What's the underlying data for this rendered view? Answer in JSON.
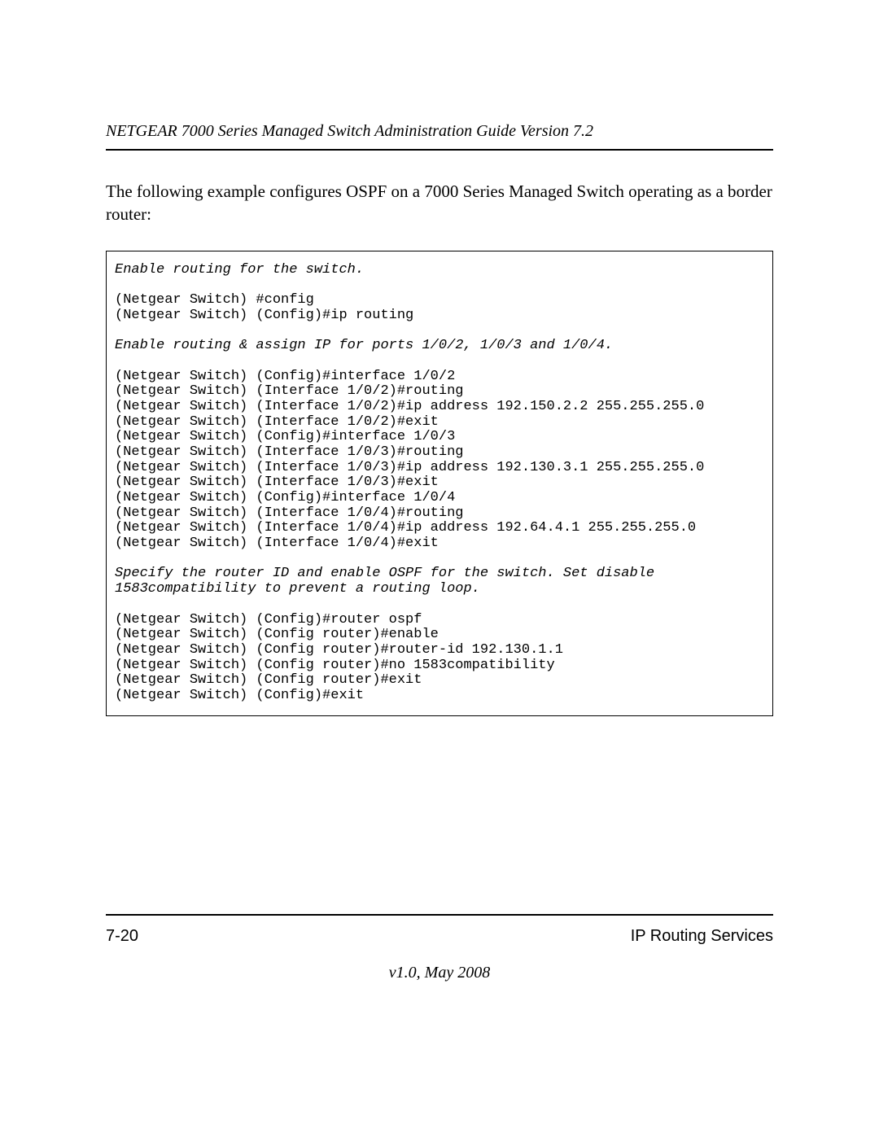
{
  "header": {
    "title": "NETGEAR 7000 Series Managed Switch Administration Guide Version 7.2"
  },
  "body": {
    "intro": "The following example configures OSPF on a 7000 Series Managed Switch operating as a border router:"
  },
  "code": {
    "comment1": "Enable routing for the switch.",
    "block1": "(Netgear Switch) #config\n(Netgear Switch) (Config)#ip routing",
    "comment2": "Enable routing & assign IP for ports 1/0/2, 1/0/3 and 1/0/4.",
    "block2": "(Netgear Switch) (Config)#interface 1/0/2\n(Netgear Switch) (Interface 1/0/2)#routing\n(Netgear Switch) (Interface 1/0/2)#ip address 192.150.2.2 255.255.255.0\n(Netgear Switch) (Interface 1/0/2)#exit\n(Netgear Switch) (Config)#interface 1/0/3\n(Netgear Switch) (Interface 1/0/3)#routing\n(Netgear Switch) (Interface 1/0/3)#ip address 192.130.3.1 255.255.255.0\n(Netgear Switch) (Interface 1/0/3)#exit\n(Netgear Switch) (Config)#interface 1/0/4\n(Netgear Switch) (Interface 1/0/4)#routing\n(Netgear Switch) (Interface 1/0/4)#ip address 192.64.4.1 255.255.255.0\n(Netgear Switch) (Interface 1/0/4)#exit",
    "comment3": "Specify the router ID and enable OSPF for the switch. Set disable\n1583compatibility to prevent a routing loop.",
    "block3": "(Netgear Switch) (Config)#router ospf\n(Netgear Switch) (Config router)#enable\n(Netgear Switch) (Config router)#router-id 192.130.1.1\n(Netgear Switch) (Config router)#no 1583compatibility\n(Netgear Switch) (Config router)#exit\n(Netgear Switch) (Config)#exit"
  },
  "footer": {
    "page_number": "7-20",
    "section": "IP Routing Services",
    "version": "v1.0, May 2008"
  }
}
